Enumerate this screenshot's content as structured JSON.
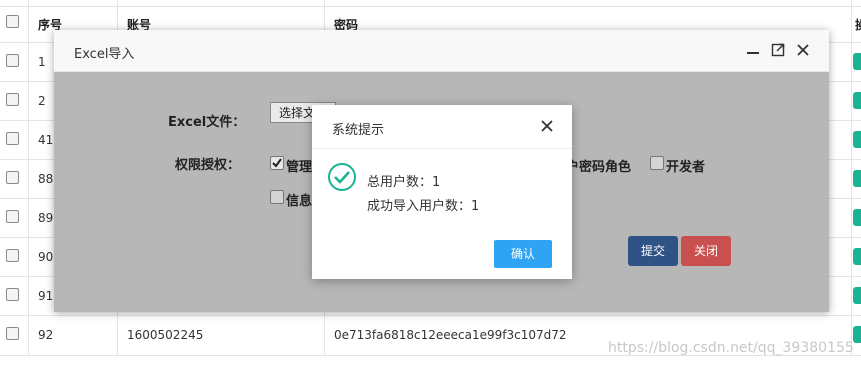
{
  "table": {
    "headers": {
      "index": "序号",
      "account": "账号",
      "password": "密码",
      "extra": "操"
    },
    "rows": [
      {
        "index": "1"
      },
      {
        "index": "2"
      },
      {
        "index": "41"
      },
      {
        "index": "88"
      },
      {
        "index": "89"
      },
      {
        "index": "90"
      },
      {
        "index": "91"
      },
      {
        "index": "92",
        "account": "1600502245",
        "password": "0e713fa6818c12eeeca1e99f3c107d72"
      }
    ]
  },
  "import_window": {
    "title": "Excel导入",
    "file_label": "Excel文件：",
    "file_button": "选择文",
    "permission_label": "权限授权：",
    "options": [
      {
        "label": "管理",
        "checked": true
      },
      {
        "label": "户密码角色",
        "checked": false
      },
      {
        "label": "开发者",
        "checked": false
      },
      {
        "label": "信息",
        "checked": false
      }
    ],
    "submit_label": "提交",
    "close_label": "关闭",
    "colors": {
      "submit": "#2f5384",
      "close": "#c9504f",
      "body": "#b7b7b7"
    }
  },
  "dialog": {
    "title": "系统提示",
    "line1": "总用户数：1",
    "line2": "成功导入用户数：1",
    "ok_label": "确认",
    "icon": "check-circle-icon",
    "colors": {
      "ok": "#2fa4f5",
      "icon": "#1ab394"
    }
  },
  "watermark": "https://blog.csdn.net/qq_39380155"
}
